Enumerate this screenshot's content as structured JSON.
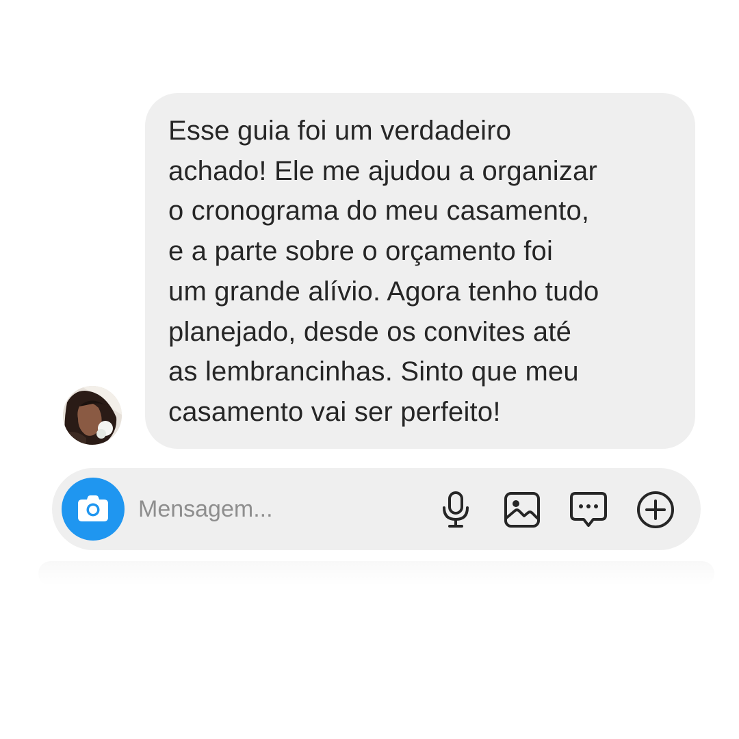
{
  "conversation": {
    "received_message": {
      "text": "Esse guia foi um verdadeiro\nachado! Ele me ajudou a organizar\no cronograma do meu casamento,\ne a parte sobre o orçamento foi\num grande alívio. Agora tenho tudo\nplanejado, desde os convites até\nas lembrancinhas. Sinto que meu\ncasamento vai ser perfeito!"
    }
  },
  "composer": {
    "placeholder": "Mensagem...",
    "value": "",
    "camera_icon": "camera-icon",
    "actions": [
      {
        "icon": "microphone-icon"
      },
      {
        "icon": "image-icon"
      },
      {
        "icon": "sticker-chat-icon"
      },
      {
        "icon": "plus-circle-icon"
      }
    ]
  },
  "colors": {
    "bubble_background": "#efefef",
    "camera_button": "#1f96f0",
    "text": "#262626",
    "placeholder": "#8e8e8e"
  }
}
